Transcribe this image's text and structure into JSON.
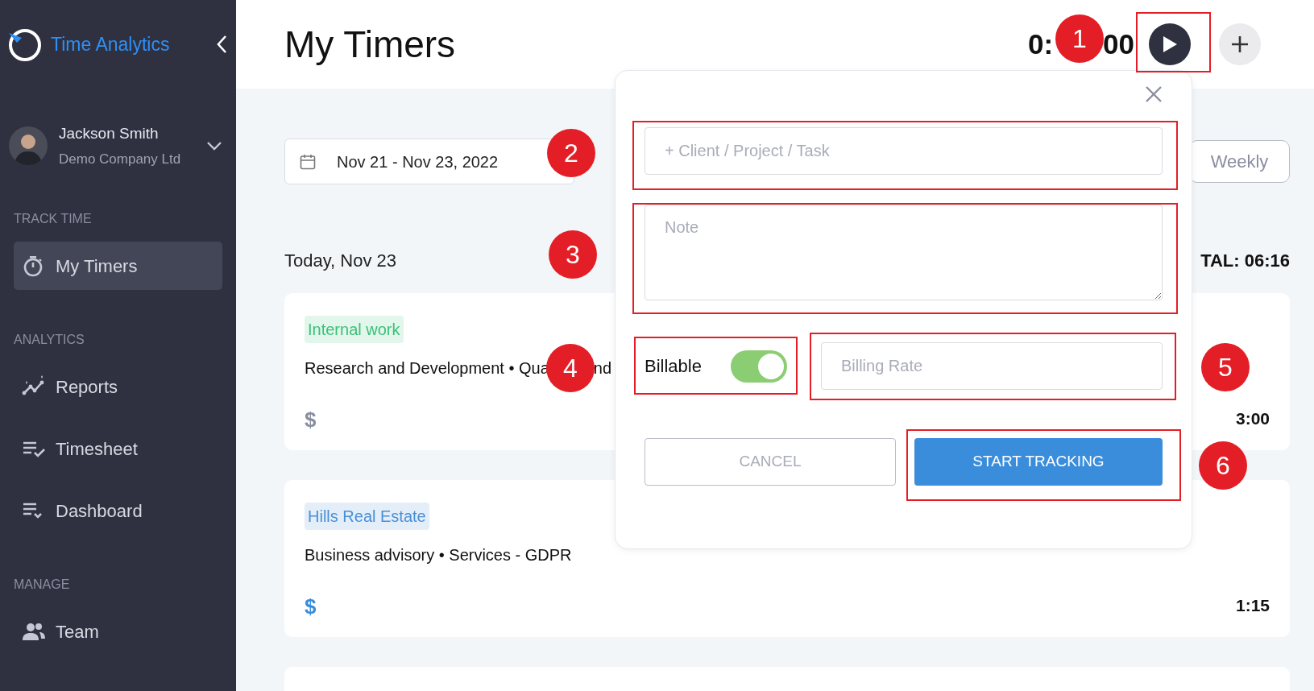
{
  "app": {
    "name": "Time Analytics"
  },
  "user": {
    "name": "Jackson Smith",
    "company": "Demo Company Ltd"
  },
  "sidebar": {
    "sections": [
      {
        "title": "TRACK TIME",
        "items": [
          {
            "label": "My Timers",
            "kind": "stopwatch",
            "selected": true
          }
        ]
      },
      {
        "title": "ANALYTICS",
        "items": [
          {
            "label": "Reports",
            "kind": "chart",
            "selected": false
          },
          {
            "label": "Timesheet",
            "kind": "listcheck",
            "selected": false
          },
          {
            "label": "Dashboard",
            "kind": "listdown",
            "selected": false
          }
        ]
      },
      {
        "title": "MANAGE",
        "items": [
          {
            "label": "Team",
            "kind": "team",
            "selected": false
          }
        ]
      }
    ]
  },
  "page": {
    "title": "My Timers",
    "timer_parts": [
      "0:",
      "00"
    ]
  },
  "filters": {
    "date_range": "Nov 21 - Nov 23, 2022",
    "view": "Weekly"
  },
  "day": {
    "label": "Today, Nov 23",
    "total": "TAL: 06:16"
  },
  "entries": [
    {
      "client": "Internal work",
      "color": "#3cc07a",
      "description_parts": [
        "Research and Development • Qua",
        "nd"
      ],
      "currency_symbol": "$",
      "billable": false,
      "duration": "3:00"
    },
    {
      "client": "Hills Real Estate",
      "color": "#4a8fd6",
      "description_parts": [
        "Business advisory • Services - GDPR"
      ],
      "currency_symbol": "$",
      "billable": true,
      "duration": "1:15"
    }
  ],
  "popup": {
    "client_placeholder": "+ Client / Project / Task",
    "note_placeholder": "Note",
    "billable_label": "Billable",
    "billable_on": true,
    "rate_placeholder": "Billing Rate",
    "cancel": "CANCEL",
    "start": "START TRACKING"
  },
  "callouts": [
    {
      "number": "1"
    },
    {
      "number": "2"
    },
    {
      "number": "3"
    },
    {
      "number": "4"
    },
    {
      "number": "5"
    },
    {
      "number": "6"
    }
  ]
}
